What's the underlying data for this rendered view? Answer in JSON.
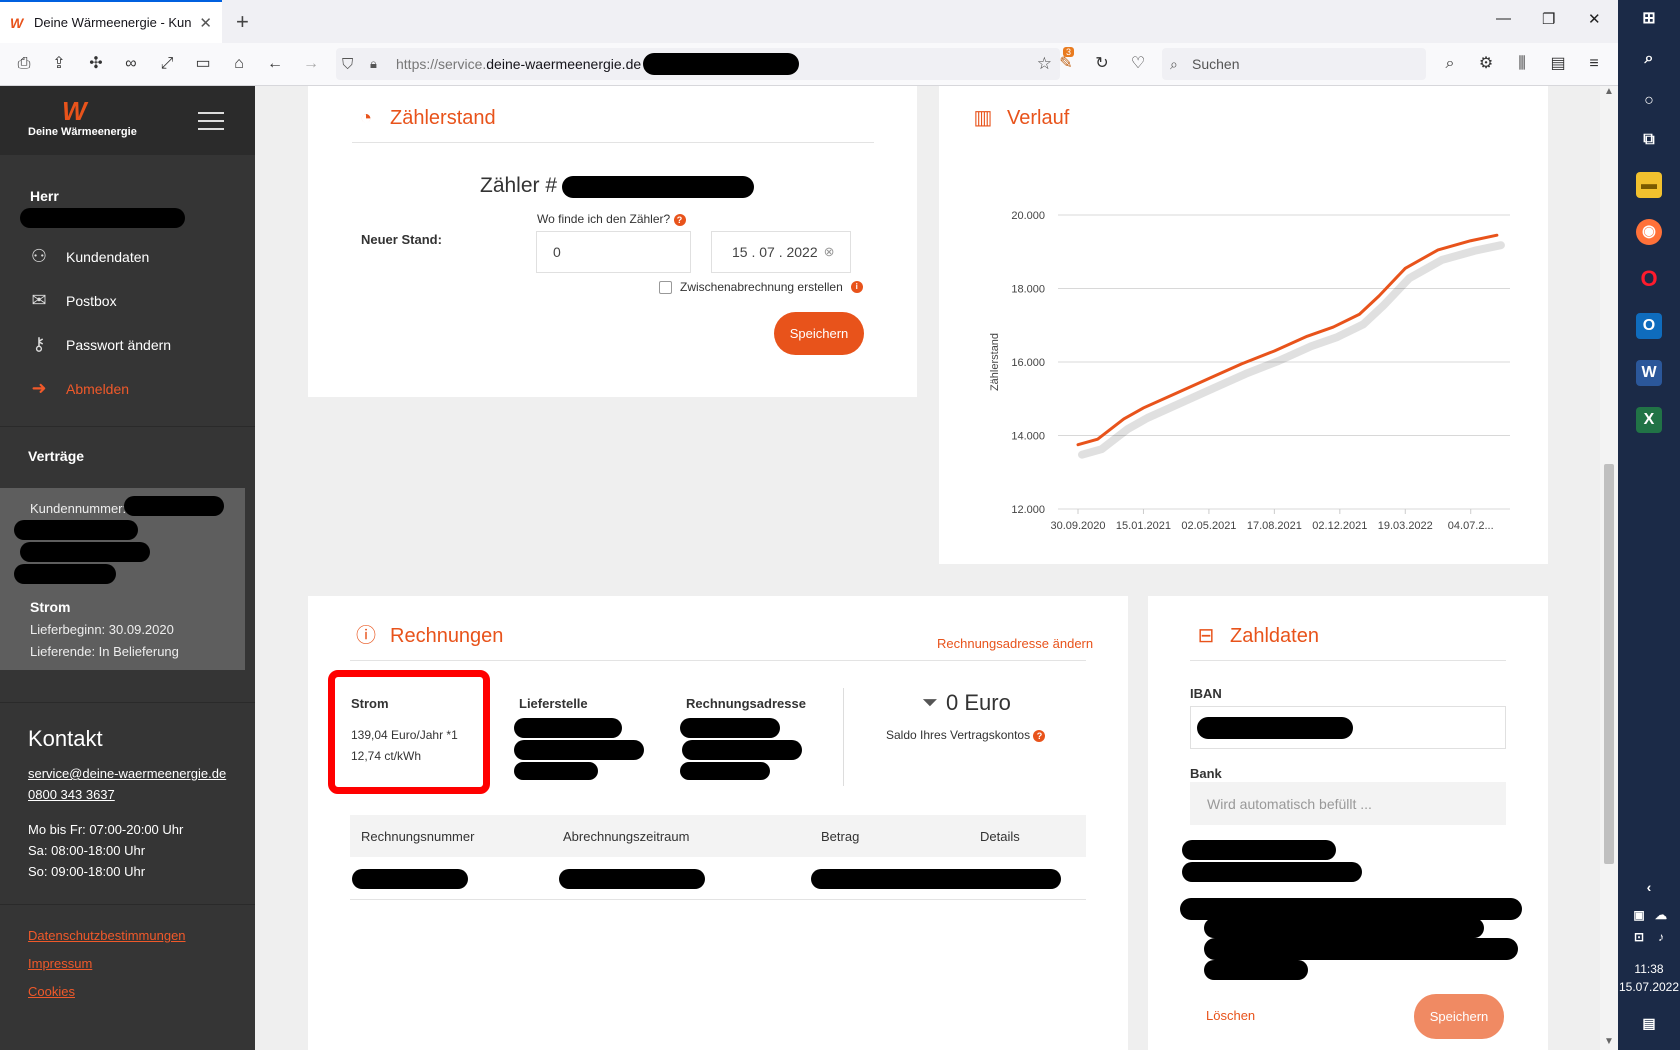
{
  "browser": {
    "tab_title": "Deine Wärmeenergie - Kunden",
    "url_prefix": "https://service.",
    "url_domain": "deine-waermeenergie.de",
    "search_placeholder": "Suchen",
    "extension_badge": "3"
  },
  "sidebar": {
    "logo_text": "Deine Wärmeenergie",
    "salutation": "Herr",
    "nav": [
      {
        "label": "Kundendaten",
        "icon": "user-icon"
      },
      {
        "label": "Postbox",
        "icon": "mail-icon"
      },
      {
        "label": "Passwort ändern",
        "icon": "key-icon"
      },
      {
        "label": "Abmelden",
        "icon": "logout-icon"
      }
    ],
    "contracts_title": "Verträge",
    "contract": {
      "customer_number_label": "Kundennummer:",
      "type": "Strom",
      "start": "Lieferbeginn: 30.09.2020",
      "end": "Lieferende: In Belieferung"
    },
    "contact": {
      "title": "Kontakt",
      "email": "service@deine-waermeenergie.de",
      "phone": "0800 343 3637",
      "hours": [
        "Mo bis Fr: 07:00-20:00 Uhr",
        "Sa: 08:00-18:00 Uhr",
        "So: 09:00-18:00 Uhr"
      ]
    },
    "footer_links": [
      "Datenschutzbestimmungen",
      "Impressum",
      "Cookies"
    ]
  },
  "meter": {
    "title": "Zählerstand",
    "counter_label": "Zähler #",
    "new_reading_label": "Neuer Stand:",
    "where_link": "Wo finde ich den Zähler?",
    "reading_value": "0",
    "date_value": "15 . 07 . 2022",
    "interim_label": "Zwischenabrechnung erstellen",
    "save": "Speichern"
  },
  "history": {
    "title": "Verlauf"
  },
  "chart_data": {
    "type": "line",
    "ylabel": "Zählerstand",
    "xlabel": "",
    "x_ticks": [
      "30.09.2020",
      "15.01.2021",
      "02.05.2021",
      "17.08.2021",
      "02.12.2021",
      "19.03.2022",
      "04.07.2..."
    ],
    "y_ticks": [
      "20.000",
      "18.000",
      "16.000",
      "14.000",
      "12.000"
    ],
    "ylim": [
      12000,
      20000
    ],
    "series": [
      {
        "color": "#e8531b",
        "x": [
          0,
          0.3,
          0.7,
          1.0,
          1.5,
          2.0,
          2.5,
          3.0,
          3.5,
          3.9,
          4.3,
          4.6,
          5.0,
          5.5,
          6.0,
          6.4
        ],
        "values": [
          13750,
          13900,
          14450,
          14750,
          15150,
          15550,
          15950,
          16300,
          16700,
          16950,
          17300,
          17800,
          18550,
          19050,
          19300,
          19450
        ]
      }
    ]
  },
  "invoices": {
    "title": "Rechnungen",
    "change_address": "Rechnungsadresse ändern",
    "strom_title": "Strom",
    "price_year": "139,04 Euro/Jahr *1",
    "price_kwh": "12,74 ct/kWh",
    "delivery_point": "Lieferstelle",
    "billing_address": "Rechnungsadresse",
    "balance": "0 Euro",
    "balance_label": "Saldo Ihres Vertragskontos",
    "columns": [
      "Rechnungsnummer",
      "Abrechnungszeitraum",
      "Betrag",
      "Details"
    ]
  },
  "payment": {
    "title": "Zahldaten",
    "iban_label": "IBAN",
    "bank_label": "Bank",
    "bank_placeholder": "Wird automatisch befüllt ...",
    "delete": "Löschen",
    "save": "Speichern"
  },
  "taskbar": {
    "time": "11:38",
    "date": "15.07.2022"
  },
  "colors": {
    "accent": "#e8531b",
    "sidebar": "#353535",
    "taskbar": "#1b2a47",
    "highlight_box": "#ff0000"
  }
}
